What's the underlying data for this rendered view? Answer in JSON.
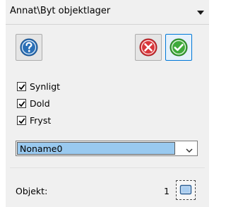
{
  "panel": {
    "title": "Annat\\Byt objektlager",
    "collapse_icon": "triangle-down-icon"
  },
  "toolbar": {
    "help_icon": "help-question-icon",
    "cancel_icon": "cancel-x-icon",
    "ok_icon": "ok-check-icon"
  },
  "options": [
    {
      "label": "Synligt",
      "checked": true
    },
    {
      "label": "Dold",
      "checked": true
    },
    {
      "label": "Fryst",
      "checked": true
    }
  ],
  "layer_select": {
    "value": "Noname0"
  },
  "objects": {
    "label": "Objekt:",
    "count": "1",
    "pick_icon": "select-object-icon"
  },
  "colors": {
    "accent": "#0078d7",
    "selection": "#99c9ef",
    "help_blue": "#2a6fb6",
    "cancel_red": "#d8363a",
    "ok_green": "#3faa3a"
  }
}
